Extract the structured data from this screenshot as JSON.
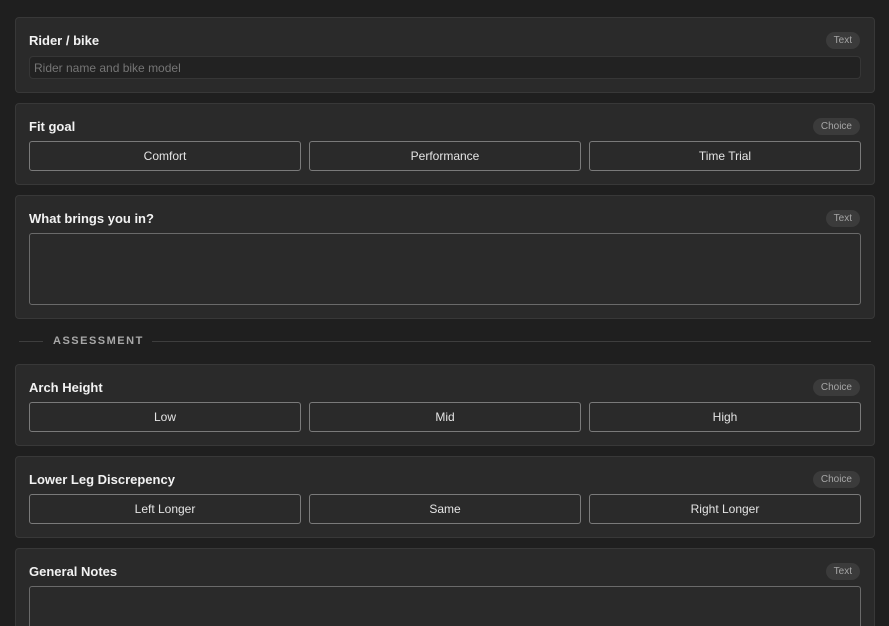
{
  "fields": {
    "rider": {
      "label": "Rider / bike",
      "badge": "Text",
      "placeholder": "Rider name and bike model"
    },
    "fit_goal": {
      "label": "Fit goal",
      "badge": "Choice",
      "options": [
        "Comfort",
        "Performance",
        "Time Trial"
      ]
    },
    "reason": {
      "label": "What brings you in?",
      "badge": "Text"
    },
    "arch_height": {
      "label": "Arch Height",
      "badge": "Choice",
      "options": [
        "Low",
        "Mid",
        "High"
      ]
    },
    "leg_discrepancy": {
      "label": "Lower Leg Discrepency",
      "badge": "Choice",
      "options": [
        "Left Longer",
        "Same",
        "Right Longer"
      ]
    },
    "general_notes": {
      "label": "General Notes",
      "badge": "Text"
    }
  },
  "sections": {
    "assessment": "ASSESSMENT"
  }
}
